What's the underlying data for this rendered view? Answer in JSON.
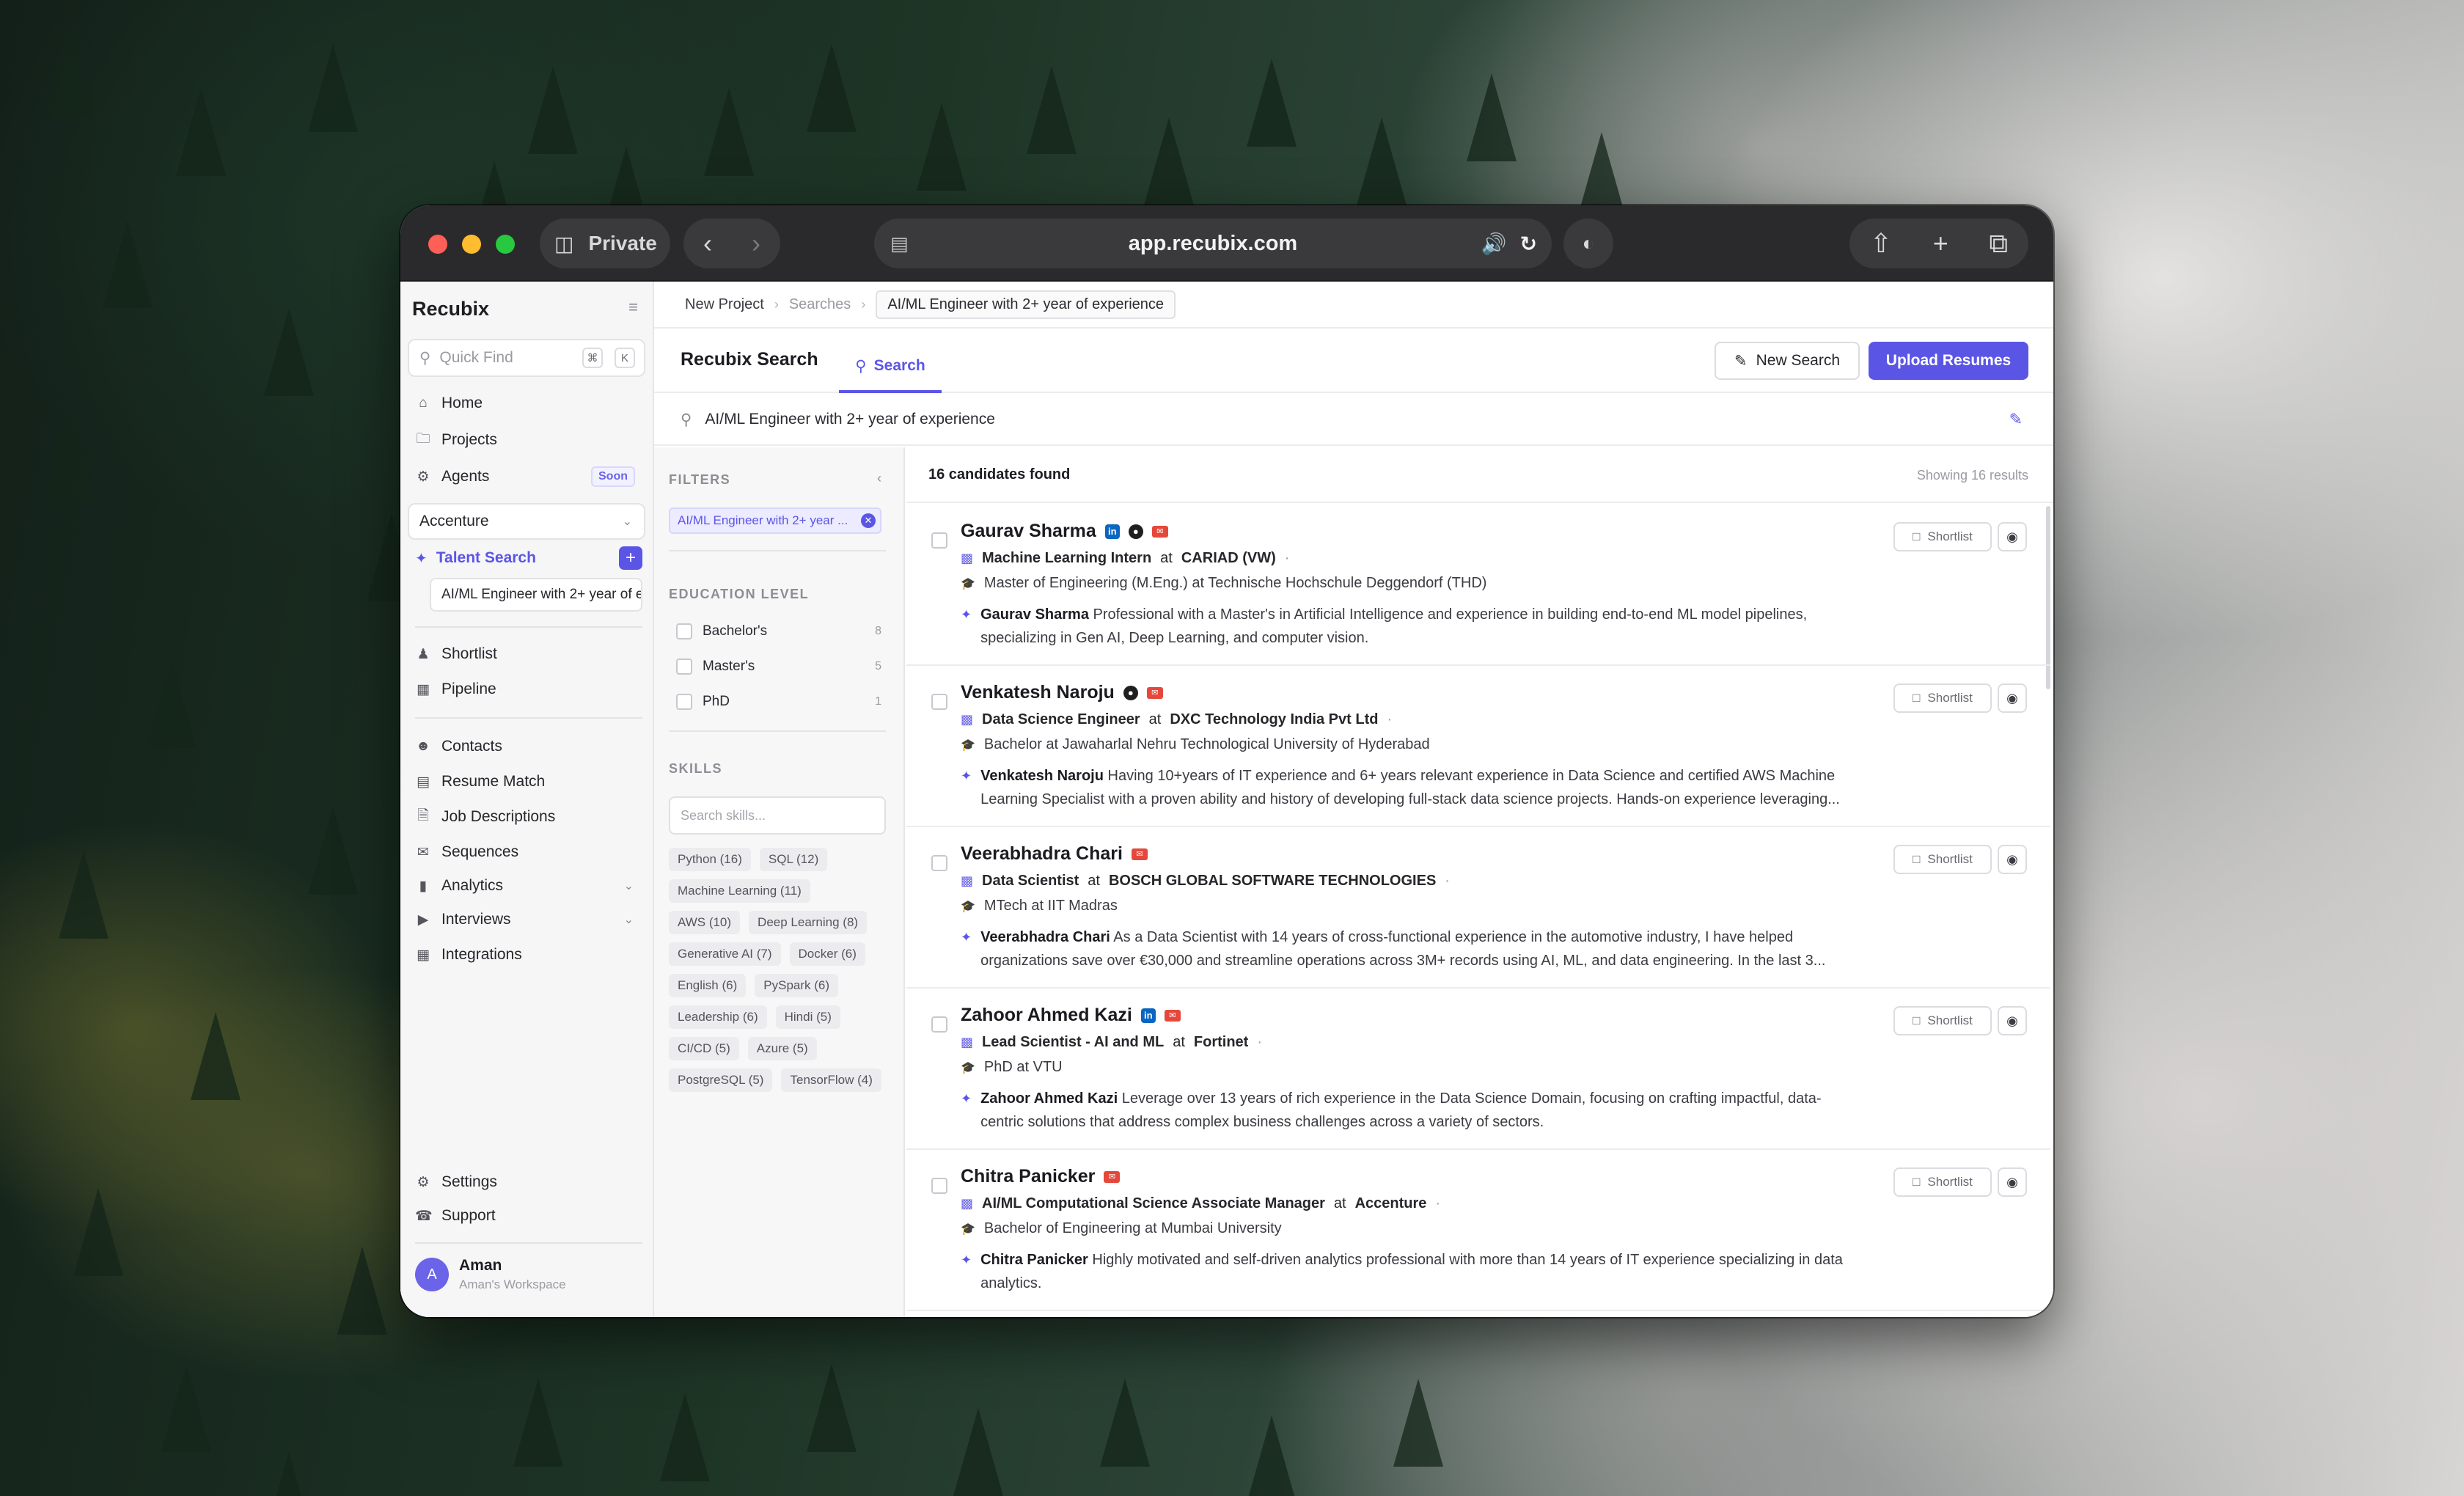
{
  "browser": {
    "private_label": "Private",
    "url": "app.recubix.com"
  },
  "sidebar": {
    "brand": "Recubix",
    "quick_find": {
      "placeholder": "Quick Find",
      "key1": "⌘",
      "key2": "K"
    },
    "nav_top": [
      {
        "label": "Home",
        "icon": "home-icon"
      },
      {
        "label": "Projects",
        "icon": "folder-icon"
      },
      {
        "label": "Agents",
        "icon": "robot-icon",
        "badge": "Soon"
      }
    ],
    "workspace": "Accenture",
    "talent_search": {
      "label": "Talent Search",
      "add": "+"
    },
    "saved_search": "AI/ML Engineer with 2+ year of experience",
    "nav_mid": [
      {
        "label": "Shortlist",
        "icon": "person-icon"
      },
      {
        "label": "Pipeline",
        "icon": "pipeline-icon"
      }
    ],
    "nav_bottom": [
      {
        "label": "Contacts",
        "icon": "contacts-icon"
      },
      {
        "label": "Resume Match",
        "icon": "resume-match-icon"
      },
      {
        "label": "Job Descriptions",
        "icon": "document-icon"
      },
      {
        "label": "Sequences",
        "icon": "mail-icon"
      },
      {
        "label": "Analytics",
        "icon": "bar-chart-icon",
        "expandable": true
      },
      {
        "label": "Interviews",
        "icon": "video-icon",
        "expandable": true
      },
      {
        "label": "Integrations",
        "icon": "grid-icon"
      }
    ],
    "footer_nav": [
      {
        "label": "Settings",
        "icon": "gear-icon"
      },
      {
        "label": "Support",
        "icon": "headset-icon"
      }
    ],
    "user": {
      "initial": "A",
      "name": "Aman",
      "workspace": "Aman's Workspace"
    }
  },
  "breadcrumb": {
    "items": [
      "New Project",
      "Searches",
      "AI/ML Engineer with 2+ year of experience"
    ]
  },
  "header": {
    "title": "Recubix Search",
    "tab": "Search",
    "new_search": "New Search",
    "upload": "Upload Resumes"
  },
  "query": "AI/ML Engineer with 2+ year of experience",
  "filters": {
    "heading": "FILTERS",
    "active_chip": "AI/ML Engineer with 2+ year ...",
    "education_heading": "EDUCATION LEVEL",
    "education": [
      {
        "label": "Bachelor's",
        "count": "8"
      },
      {
        "label": "Master's",
        "count": "5"
      },
      {
        "label": "PhD",
        "count": "1"
      }
    ],
    "skills_heading": "SKILLS",
    "skills_placeholder": "Search skills...",
    "skills": [
      "Python (16)",
      "SQL (12)",
      "Machine Learning (11)",
      "AWS (10)",
      "Deep Learning (8)",
      "Generative AI (7)",
      "Docker (6)",
      "English (6)",
      "PySpark (6)",
      "Leadership (6)",
      "Hindi (5)",
      "CI/CD (5)",
      "Azure (5)",
      "PostgreSQL (5)",
      "TensorFlow (4)"
    ]
  },
  "results": {
    "count": "16 candidates found",
    "showing": "Showing 16 results",
    "shortlist_label": "Shortlist",
    "candidates": [
      {
        "name": "Gaurav Sharma",
        "socials": [
          "in",
          "gh",
          "mail"
        ],
        "title": "Machine Learning Intern",
        "at": "at",
        "company": "CARIAD (VW)",
        "education": "Master of Engineering (M.Eng.) at Technische Hochschule Deggendorf (THD)",
        "summary": "Professional with a Master's in Artificial Intelligence and experience in building end-to-end ML model pipelines, specializing in Gen AI, Deep Learning, and computer vision."
      },
      {
        "name": "Venkatesh Naroju",
        "socials": [
          "gh",
          "mail"
        ],
        "title": "Data Science Engineer",
        "at": "at",
        "company": "DXC Technology India Pvt Ltd",
        "education": "Bachelor at Jawaharlal Nehru Technological University of Hyderabad",
        "summary": "Having 10+years of IT experience and 6+ years relevant experience in Data Science and certified AWS Machine Learning Specialist with a proven ability and history of developing full-stack data science projects. Hands-on experience leveraging..."
      },
      {
        "name": "Veerabhadra Chari",
        "socials": [
          "mail"
        ],
        "title": "Data Scientist",
        "at": "at",
        "company": "BOSCH GLOBAL SOFTWARE TECHNOLOGIES",
        "education": "MTech at IIT Madras",
        "summary": "As a Data Scientist with 14 years of cross-functional experience in the automotive industry, I have helped organizations save over €30,000 and streamline operations across 3M+ records using AI, ML, and data engineering. In the last 3..."
      },
      {
        "name": "Zahoor Ahmed Kazi",
        "socials": [
          "in",
          "mail"
        ],
        "title": "Lead Scientist - AI and ML",
        "at": "at",
        "company": "Fortinet",
        "education": "PhD at VTU",
        "summary": "Leverage over 13 years of rich experience in the Data Science Domain, focusing on crafting impactful, data-centric solutions that address complex business challenges across a variety of sectors."
      },
      {
        "name": "Chitra Panicker",
        "socials": [
          "mail"
        ],
        "title": "AI/ML Computational Science Associate Manager",
        "at": "at",
        "company": "Accenture",
        "education": "Bachelor of Engineering at Mumbai University",
        "summary": "Highly motivated and self-driven analytics professional with more than 14 years of IT experience specializing in data analytics."
      }
    ]
  }
}
